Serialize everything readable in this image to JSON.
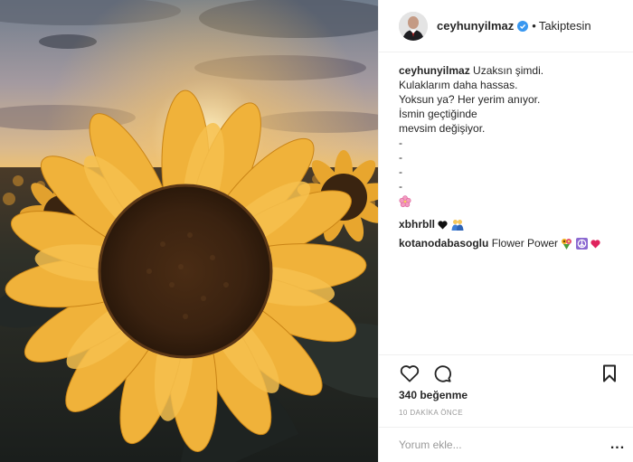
{
  "post": {
    "username": "ceyhunyilmaz",
    "follow_separator": "•",
    "follow_status": "Takiptesin",
    "verified": true
  },
  "caption": {
    "username": "ceyhunyilmaz",
    "lines": [
      "Uzaksın şimdi.",
      "Kulaklarım daha hassas.",
      "Yoksun ya? Her yerim anıyor.",
      "İsmin geçtiğinde",
      "mevsim değişiyor.",
      "-",
      "-",
      "-",
      "-"
    ],
    "trailing_emoji": "cherry-blossom"
  },
  "comments": [
    {
      "username": "xbhrbll",
      "text": "",
      "emojis": [
        "black-heart",
        "people-hugging"
      ]
    },
    {
      "username": "kotanodabasoglu",
      "text": "Flower Power",
      "emojis": [
        "sunflower-bouquet",
        "peace-symbol",
        "heart"
      ]
    }
  ],
  "likes": "340 beğenme",
  "timestamp": "10 DAKİKA ÖNCE",
  "add_comment": {
    "placeholder": "Yorum ekle...",
    "more_label": "..."
  },
  "colors": {
    "accent": "#3897f0",
    "text": "#262626",
    "muted": "#999999",
    "divider": "#efefef"
  }
}
